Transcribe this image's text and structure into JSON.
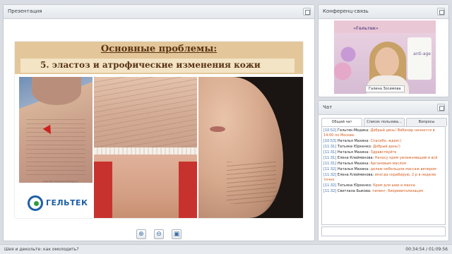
{
  "presentation": {
    "title": "Презентация",
    "slide": {
      "title": "Основные проблемы:",
      "subtitle": "5. эластоз и атрофические изменения кожи",
      "credit": "www.http://www.dermatology.ru/",
      "logo_text": "ГЕЛЬТЕК"
    },
    "toolbar": [
      {
        "name": "zoom-in-button",
        "icon": "zoom-in-icon",
        "glyph": "⊕"
      },
      {
        "name": "zoom-out-button",
        "icon": "zoom-out-icon",
        "glyph": "⊖"
      },
      {
        "name": "save-button",
        "icon": "save-icon",
        "glyph": "▣"
      }
    ]
  },
  "conference": {
    "title": "Конференц-связь",
    "video": {
      "brand": "«Гельтек»",
      "bottle_text": "anti-age",
      "speaker_name": "Галина Зосимова"
    }
  },
  "chat": {
    "title": "Чат",
    "tabs": [
      "Общий чат",
      "Список пользова...",
      "Вопросы"
    ],
    "messages": [
      {
        "time": "[10:52]",
        "author": "Гельтек-Медика:",
        "text": "Добрый день! Вебинар начнется в 14:00 по Москве."
      },
      {
        "time": "[10:53]",
        "author": "Наталья Махина:",
        "text": "Спасибо, ждем:)"
      },
      {
        "time": "[11:31]",
        "author": "Татьяна Юркенко:",
        "text": "Добрый день!)"
      },
      {
        "time": "[11:31]",
        "author": "Наталья Махина:",
        "text": "Здравствуйте"
      },
      {
        "time": "[11:31]",
        "author": "Елена Клейменова:",
        "text": "Наносу крем увлажняющий и всё"
      },
      {
        "time": "[11:31]",
        "author": "Наталья Махина:",
        "text": "Аргановым маслом"
      },
      {
        "time": "[11:32]",
        "author": "Наталья Махина:",
        "text": "делаю небольшое массаж вечером"
      },
      {
        "time": "[11:32]",
        "author": "Елена Клейменова:",
        "text": "иногда скрабирую, 2 р в неделю точно"
      },
      {
        "time": "[11:32]",
        "author": "Татьяна Юркенко:",
        "text": "Крем для шеи и маска."
      },
      {
        "time": "[11:32]",
        "author": "Светлана Быкова:",
        "text": "пилинг, биоревитализация"
      }
    ]
  },
  "status": {
    "title": "Шея и декольте: как омолодить?",
    "time": "00:34:54 / 01:09:56"
  }
}
